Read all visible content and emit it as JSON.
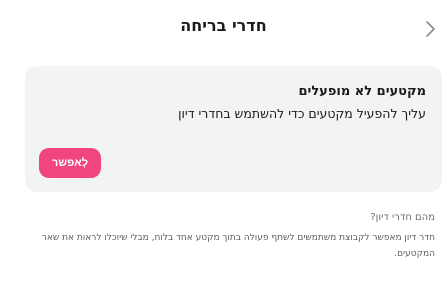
{
  "header": {
    "title": "חדרי בריחה",
    "back_icon": "chevron-right-icon"
  },
  "notice": {
    "title": "מקטעים לא מופעלים",
    "message": "עליך להפעיל מקטעים כדי להשתמש בחדרי דיון",
    "enable_label": "לְאפשר",
    "accent_color": "#f0457f"
  },
  "info": {
    "question": "מהם חדרי דיון?",
    "description": "חדר דיון מאפשר לקבוצת משתמשים לשתף פעולה בתוך מקטע אחד בלוח, מבלי שיוכלו לראות את שאר המקטעים."
  }
}
